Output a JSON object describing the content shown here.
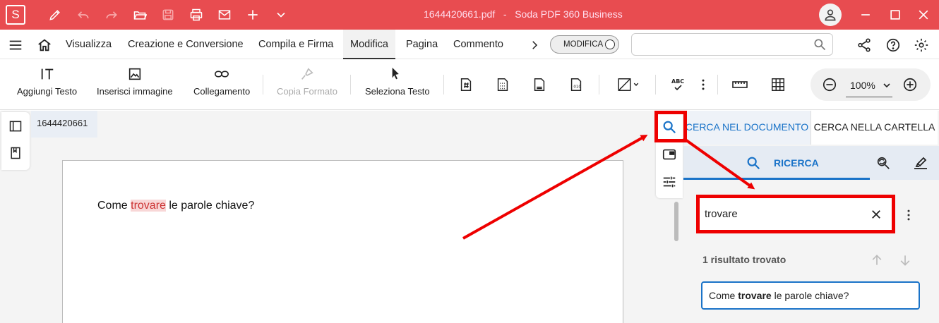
{
  "app": {
    "logo_letter": "S",
    "title": "1644420661.pdf   -   Soda PDF 360 Business",
    "accent_color": "#e84c50",
    "titlebar_icons": [
      "pen-icon",
      "undo-icon",
      "redo-icon",
      "open-folder-icon",
      "save-icon",
      "print-icon",
      "mail-icon",
      "plus-icon",
      "chevron-down-icon"
    ],
    "window_controls": [
      "user-icon",
      "minimize-icon",
      "maximize-icon",
      "close-icon"
    ]
  },
  "menubar": {
    "items": [
      "Visualizza",
      "Creazione e Conversione",
      "Compila e Firma",
      "Modifica",
      "Pagina",
      "Commento"
    ],
    "active": "Modifica",
    "mode_label": "MODIFICA",
    "search_placeholder": ""
  },
  "toolbar": {
    "add_text": "Aggiungi Testo",
    "insert_image": "Inserisci immagine",
    "link": "Collegamento",
    "copy_format": "Copia Formato",
    "select_text": "Seleziona Testo",
    "zoom": "100%"
  },
  "document": {
    "tab_name": "1644420661",
    "text_before": "Come ",
    "highlight": "trovare",
    "text_after": " le parole chiave?"
  },
  "search_panel": {
    "tab_document": "CERCA NEL DOCUMENTO",
    "tab_folder": "CERCA NELLA CARTELLA",
    "subtab_label": "RICERCA",
    "query": "trovare",
    "results_count": "1 risultato trovato",
    "result_before": "Come ",
    "result_match": "trovare",
    "result_after": " le parole chiave?",
    "highlight_color": "#1a73c8"
  }
}
